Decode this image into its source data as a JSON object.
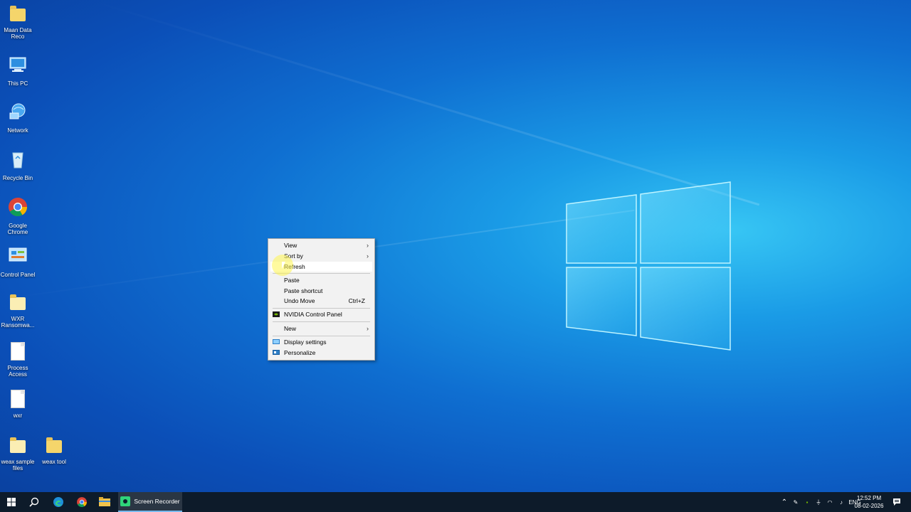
{
  "desktop_icons": [
    {
      "label": "Maan Data Reco"
    },
    {
      "label": "This PC"
    },
    {
      "label": "Network"
    },
    {
      "label": "Recycle Bin"
    },
    {
      "label": "Google Chrome"
    },
    {
      "label": "Control Panel"
    },
    {
      "label": "WXR Ransomwa..."
    },
    {
      "label": "Process Access"
    },
    {
      "label": "wxr"
    },
    {
      "label": "weax sample files"
    },
    {
      "label": "weax tool"
    }
  ],
  "context_menu": {
    "view": "View",
    "sort_by": "Sort by",
    "refresh": "Refresh",
    "paste": "Paste",
    "paste_shortcut": "Paste shortcut",
    "undo_move": "Undo Move",
    "undo_shortcut": "Ctrl+Z",
    "nvidia": "NVIDIA Control Panel",
    "new": "New",
    "display_settings": "Display settings",
    "personalize": "Personalize"
  },
  "taskbar": {
    "screen_recorder": "Screen Recorder",
    "language": "ENG",
    "time": "12:52 PM",
    "date": "08-02-2026"
  },
  "colors": {
    "taskbar_bg": "#0d1b2a",
    "accent": "#76b9ed"
  }
}
